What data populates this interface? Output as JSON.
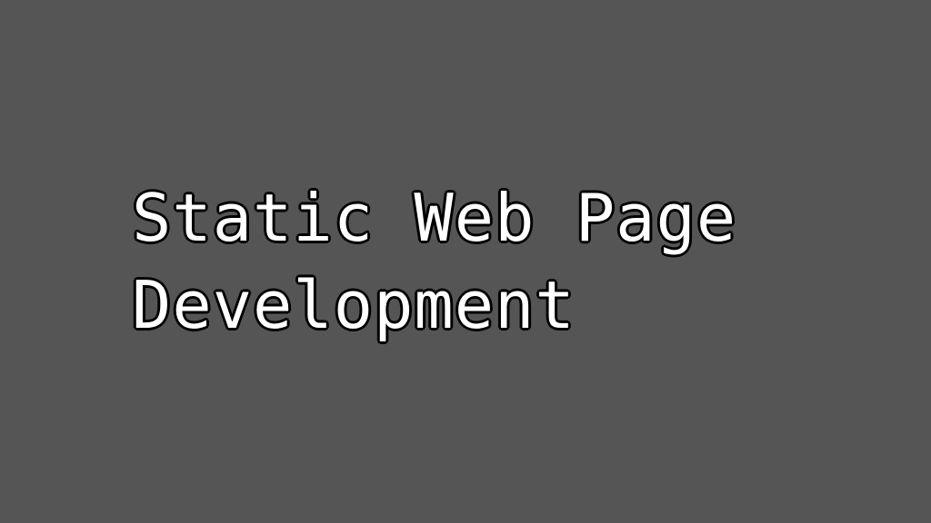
{
  "slide": {
    "background_color": "#555555",
    "title_lines": [
      "Static Web Page",
      "Development"
    ],
    "text_color": "#ffffff",
    "outline_color": "#000000"
  }
}
